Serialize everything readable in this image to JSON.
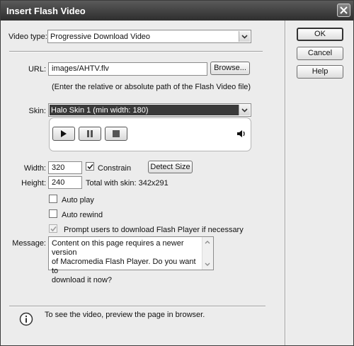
{
  "window": {
    "title": "Insert Flash Video"
  },
  "video_type": {
    "label": "Video type:",
    "value": "Progressive Download Video"
  },
  "url": {
    "label": "URL:",
    "value": "images/AHTV.flv",
    "browse_label": "Browse...",
    "hint": "(Enter the relative or absolute path of the Flash Video file)"
  },
  "skin": {
    "label": "Skin:",
    "value": "Halo Skin 1 (min width: 180)"
  },
  "width": {
    "label": "Width:",
    "value": "320",
    "constrain_label": "Constrain",
    "constrain_checked": true,
    "detect_label": "Detect Size"
  },
  "height": {
    "label": "Height:",
    "value": "240",
    "total_text": "Total with skin: 342x291"
  },
  "options": {
    "autoplay_label": "Auto play",
    "autorewind_label": "Auto rewind",
    "prompt_label": "Prompt users to download Flash Player if necessary"
  },
  "message": {
    "label": "Message:",
    "value": "Content on this page requires a newer version\nof Macromedia Flash Player. Do you want to\ndownload it now?"
  },
  "buttons": {
    "ok": "OK",
    "cancel": "Cancel",
    "help": "Help"
  },
  "info": {
    "text": "To see the video, preview the page in browser."
  },
  "colors": {
    "titlebar": "#3b3b3b",
    "dialog_bg": "#ececec",
    "skin_highlight": "#3a3a3a"
  }
}
